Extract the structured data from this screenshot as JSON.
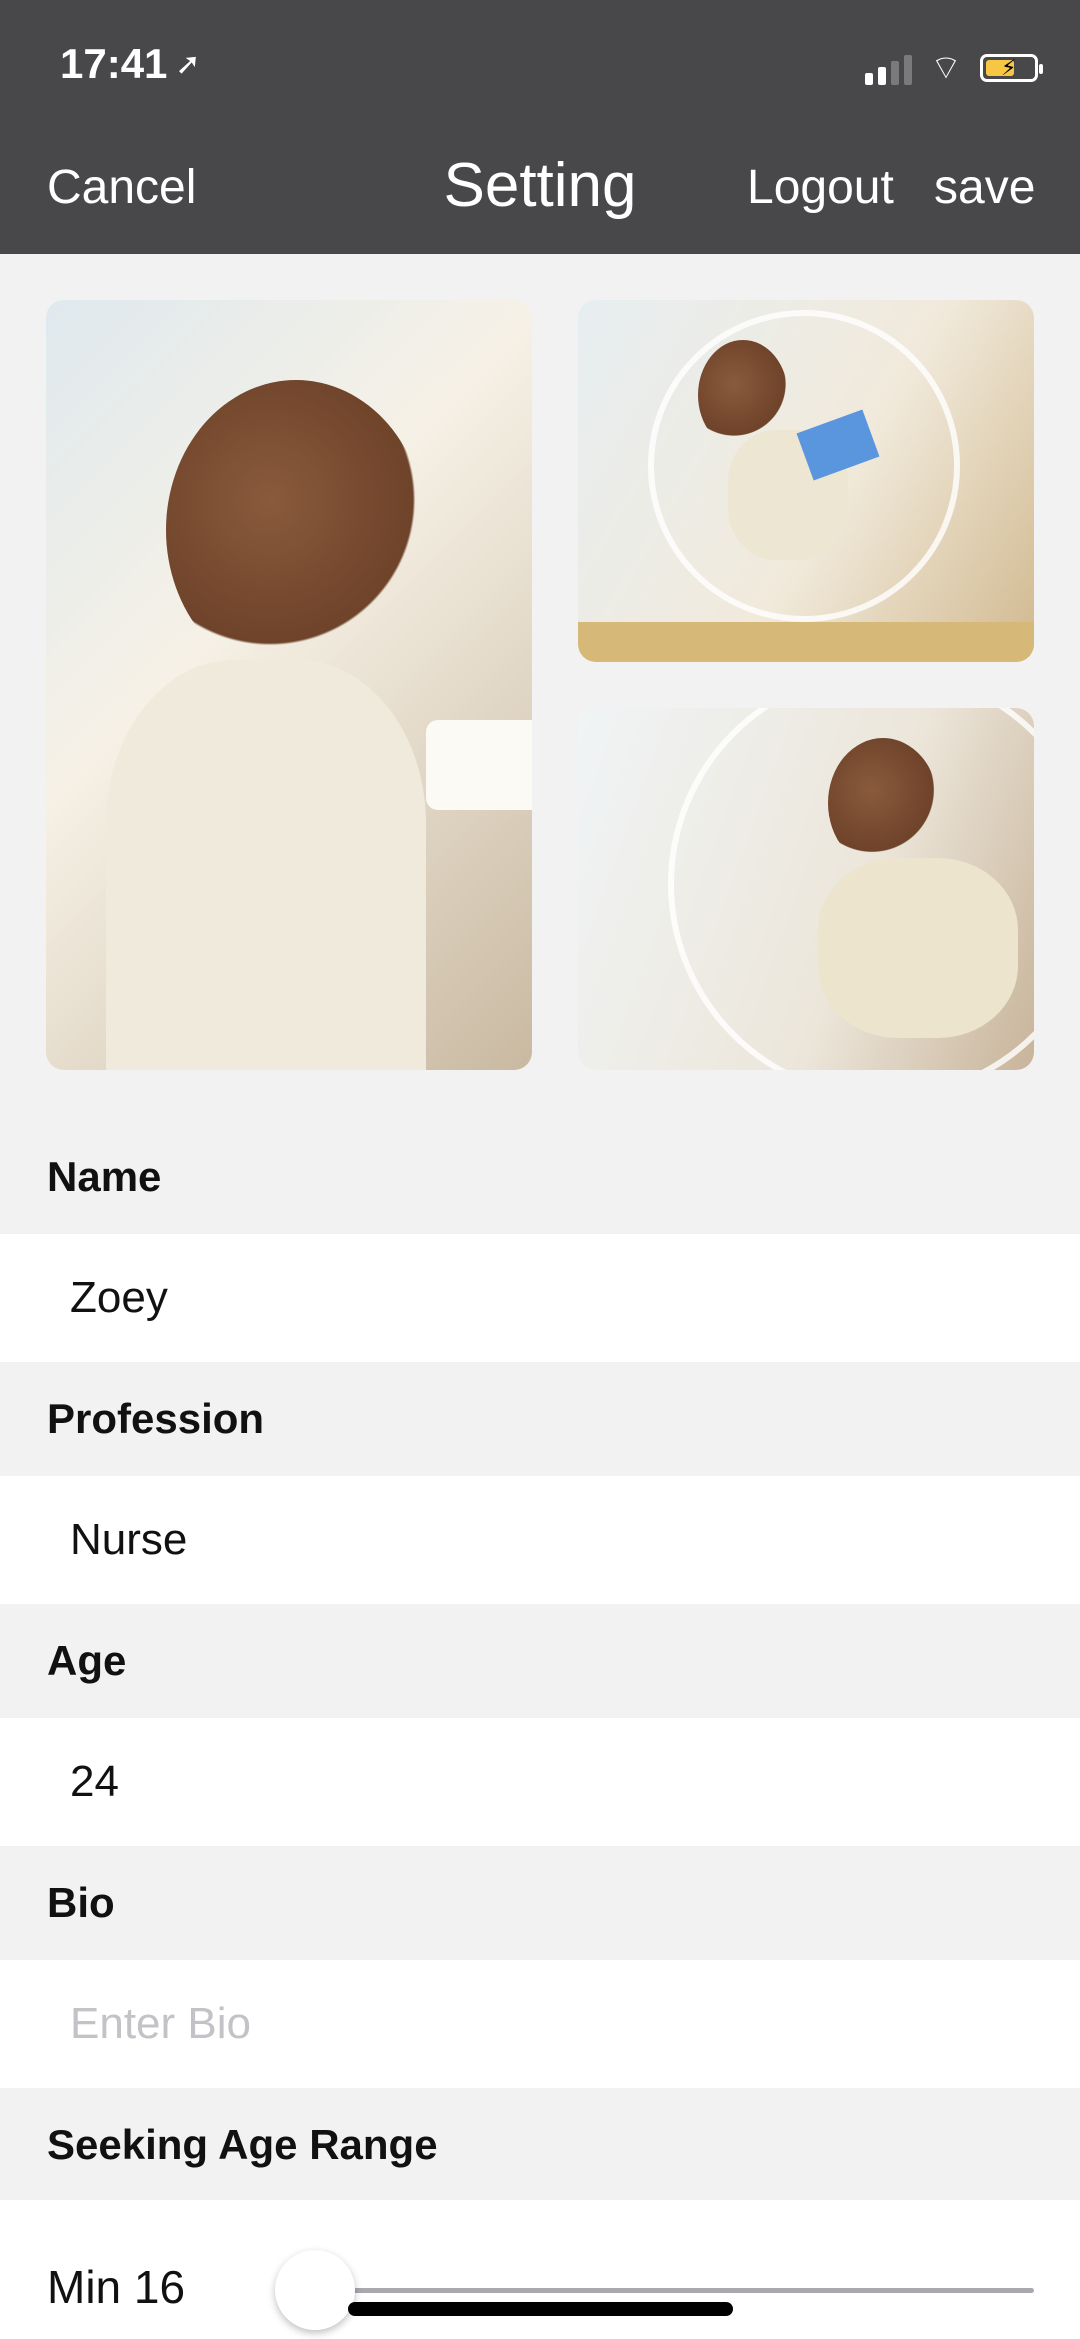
{
  "status_bar": {
    "time": "17:41"
  },
  "nav": {
    "cancel": "Cancel",
    "title": "Setting",
    "logout": "Logout",
    "save": "save"
  },
  "photos": {
    "main": "woman smiling holding teacup",
    "top_right": "woman reading tablet in bubble chair",
    "bottom_right": "woman relaxing in bubble chair"
  },
  "form": {
    "name": {
      "label": "Name",
      "value": "Zoey"
    },
    "profession": {
      "label": "Profession",
      "value": "Nurse"
    },
    "age": {
      "label": "Age",
      "value": "24"
    },
    "bio": {
      "label": "Bio",
      "placeholder": "Enter Bio"
    },
    "seeking_age_range": {
      "label": "Seeking Age Range",
      "min_label": "Min 16",
      "min_value": 16
    }
  },
  "colors": {
    "topbar": "#48484a",
    "background": "#f2f2f2",
    "battery": "#f7c744"
  }
}
